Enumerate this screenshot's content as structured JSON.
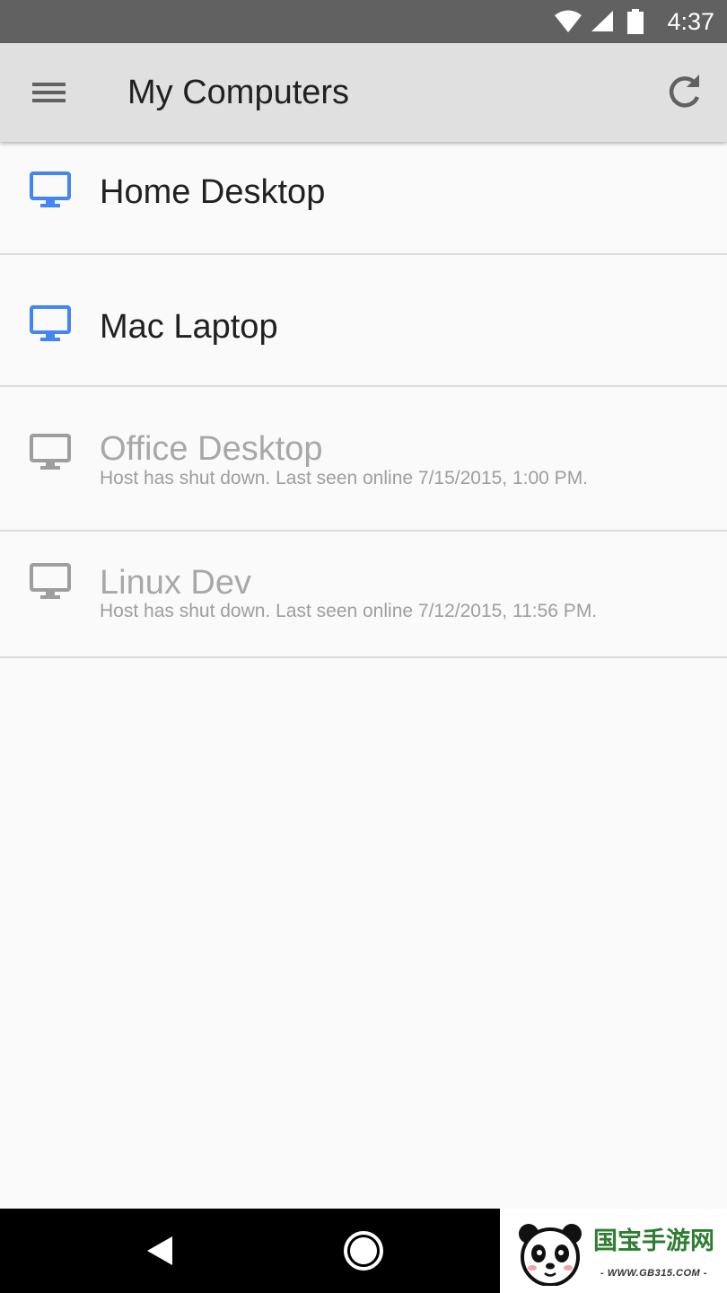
{
  "status_bar": {
    "time": "4:37",
    "icons": [
      "wifi-icon",
      "cell-signal-icon",
      "battery-icon"
    ]
  },
  "app_bar": {
    "title": "My Computers",
    "menu_icon": "hamburger-menu-icon",
    "refresh_icon": "refresh-icon"
  },
  "colors": {
    "online_icon": "#4285f4",
    "offline_icon": "#9e9e9e",
    "app_bar": "#e0e0e0",
    "status_bar": "#616161"
  },
  "computers": [
    {
      "name": "Home Desktop",
      "status": "online",
      "subtitle": ""
    },
    {
      "name": "Mac Laptop",
      "status": "online",
      "subtitle": ""
    },
    {
      "name": "Office Desktop",
      "status": "offline",
      "subtitle": "Host has shut down. Last seen online 7/15/2015, 1:00 PM."
    },
    {
      "name": "Linux Dev",
      "status": "offline",
      "subtitle": "Host has shut down. Last seen online 7/12/2015, 11:56 PM."
    }
  ],
  "nav_bar": {
    "icons": [
      "back-icon",
      "home-icon"
    ]
  },
  "watermark": {
    "text": "国宝手游网",
    "url": "- WWW.GB315.COM -"
  }
}
